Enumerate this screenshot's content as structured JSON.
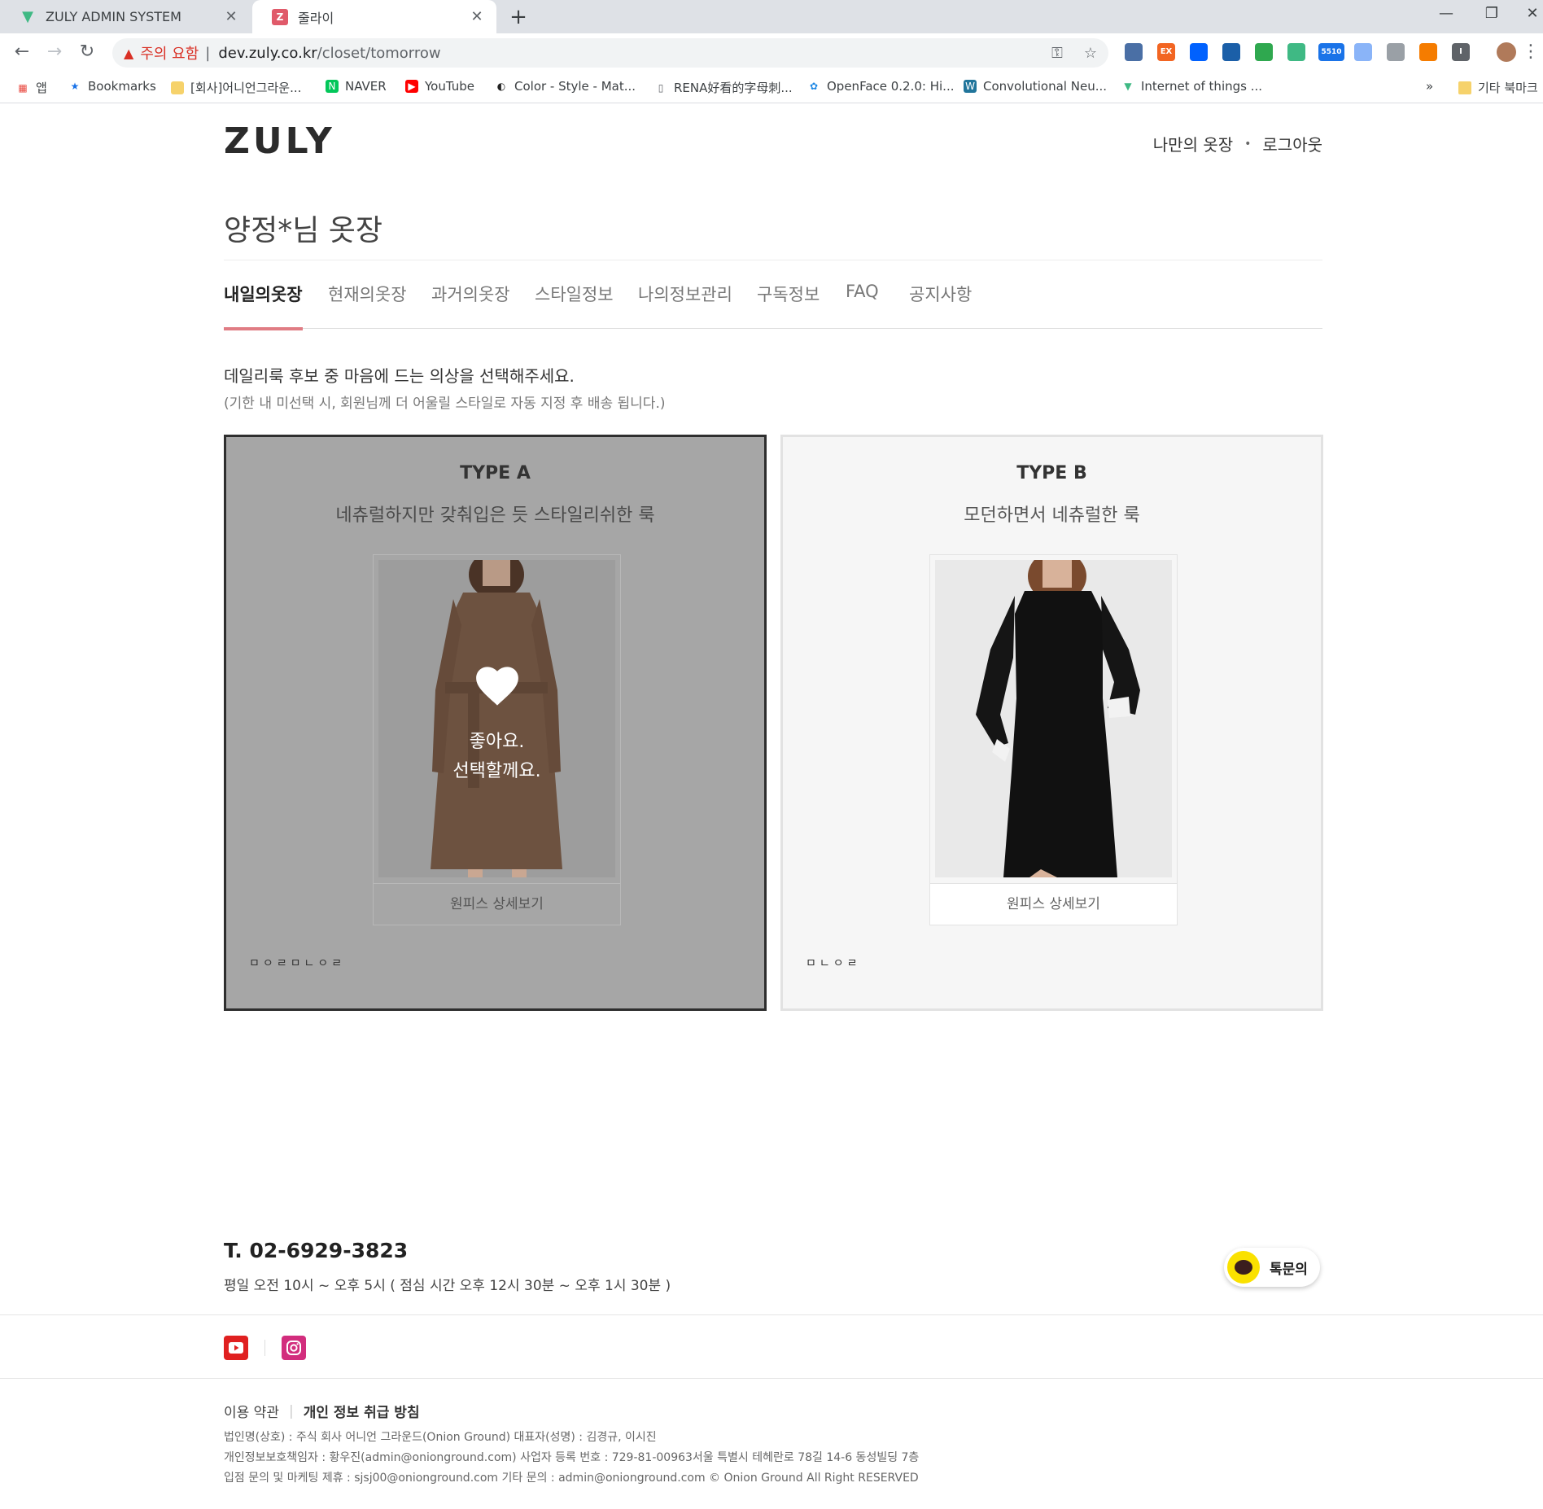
{
  "browser": {
    "tabs": [
      {
        "title": "ZULY ADMIN SYSTEM",
        "favicon": "vue-logo-icon"
      },
      {
        "title": "줄라이",
        "favicon": "z-logo-icon",
        "favicon_letter": "Z"
      }
    ],
    "address": {
      "warning": "주의 요함",
      "separator": "|",
      "host": "dev.zuly.co.kr",
      "path": "/closet/tomorrow"
    },
    "extensions": [
      {
        "name": "globe-ext-icon",
        "color": "#4a6fa5",
        "label": ""
      },
      {
        "name": "ex-ext-icon",
        "color": "#f26522",
        "label": "EX"
      },
      {
        "name": "dropbox-ext-icon",
        "color": "#0061fe",
        "label": ""
      },
      {
        "name": "card-ext-icon",
        "color": "#1b5fa8",
        "label": ""
      },
      {
        "name": "shield-ext-icon",
        "color": "#2fa84f",
        "label": ""
      },
      {
        "name": "vue-ext-icon",
        "color": "#3fb984",
        "label": ""
      },
      {
        "name": "counter-ext-icon",
        "color": "#1a73e8",
        "label": "5510"
      },
      {
        "name": "send-ext-icon",
        "color": "#8ab4f8",
        "label": ""
      },
      {
        "name": "memo-ext-icon",
        "color": "#9aa0a6",
        "label": ""
      },
      {
        "name": "chart-ext-icon",
        "color": "#f57c00",
        "label": ""
      },
      {
        "name": "info-ext-icon",
        "color": "#5f6368",
        "label": "I"
      }
    ],
    "bookmarks": [
      {
        "label": "앱",
        "icon": "apps-grid-icon"
      },
      {
        "label": "Bookmarks",
        "icon": "star-icon"
      },
      {
        "label": "[회사]어니언그라운...",
        "icon": "folder-icon"
      },
      {
        "label": "NAVER",
        "icon": "naver-icon"
      },
      {
        "label": "YouTube",
        "icon": "youtube-icon"
      },
      {
        "label": "Color - Style - Mat...",
        "icon": "material-icon"
      },
      {
        "label": "RENA好看的字母刺...",
        "icon": "page-icon"
      },
      {
        "label": "OpenFace 0.2.0: Hi...",
        "icon": "paw-icon"
      },
      {
        "label": "Convolutional Neu...",
        "icon": "wordpress-icon"
      },
      {
        "label": "Internet of things ...",
        "icon": "vuetify-icon"
      }
    ],
    "bookmarks_more": "»",
    "other_bookmarks": "기타 북마크"
  },
  "header": {
    "logo": "ZULY",
    "nav": {
      "my_closet": "나만의 옷장",
      "dot": "•",
      "logout": "로그아웃"
    }
  },
  "closet": {
    "title": "양정*님 옷장",
    "tabs": [
      "내일의옷장",
      "현재의옷장",
      "과거의옷장",
      "스타일정보",
      "나의정보관리",
      "구독정보",
      "FAQ",
      "공지사항"
    ],
    "active_tab": "내일의옷장",
    "guide_main": "데일리룩 후보 중 마음에 드는 의상을 선택해주세요.",
    "guide_sub": "(기한 내 미선택 시, 회원님께 더 어울릴 스타일로 자동 지정 후 배송 됩니다.)"
  },
  "options": [
    {
      "type": "TYPE A",
      "desc": "네츄럴하지만 갖춰입은 듯 스타일리쉬한 룩",
      "detail_label": "원피스 상세보기",
      "brand": "ㅁㅇㄹㅁㄴㅇㄹ",
      "selected": true,
      "overlay_line1": "좋아요.",
      "overlay_line2": "선택할께요.",
      "dress_color": "#6d5240"
    },
    {
      "type": "TYPE B",
      "desc": "모던하면서 네츄럴한 룩",
      "detail_label": "원피스 상세보기",
      "brand": "ㅁㄴㅇㄹ",
      "selected": false,
      "dress_color": "#111111"
    }
  ],
  "footer": {
    "phone": "T. 02-6929-3823",
    "hours": "평일 오전 10시 ~ 오후 5시 ( 점심 시간 오후 12시 30분 ~ 오후 1시 30분 )",
    "kakao_label": "톡문의",
    "terms": "이용 약관",
    "policy_sep": "|",
    "privacy": "개인 정보 취급 방침",
    "corp_line1": "법인명(상호) : 주식 회사 어니언 그라운드(Onion Ground) 대표자(성명) : 김경규, 이시진",
    "corp_line2": "개인정보보호책임자 : 황우진(admin@onionground.com) 사업자 등록 번호 : 729-81-00963서울 특별시 테헤란로 78길 14-6 동성빌딩 7층",
    "corp_line3": "입점 문의 및 마케팅 제휴 : sjsj00@onionground.com 기타 문의 : admin@onionground.com © Onion Ground All Right RESERVED"
  },
  "colors": {
    "accent": "#e07c84",
    "selected_card_bg": "#a6a6a6",
    "kakao_yellow": "#fae100"
  }
}
